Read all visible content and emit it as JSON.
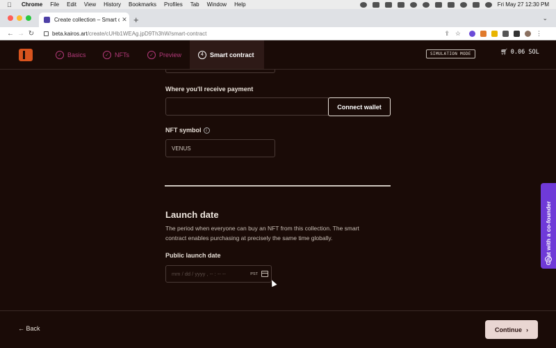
{
  "menubar": {
    "app": "Chrome",
    "items": [
      "File",
      "Edit",
      "View",
      "History",
      "Bookmarks",
      "Profiles",
      "Tab",
      "Window",
      "Help"
    ],
    "clock": "Fri May 27  12:30 PM"
  },
  "browser": {
    "tab_title": "Create collection – Smart cont",
    "url_domain": "beta.kairos.art",
    "url_path": "/create/cUHb1WEAg.jpD9Th3hW/smart-contract"
  },
  "header": {
    "steps": [
      {
        "label": "Basics"
      },
      {
        "label": "NFTs"
      },
      {
        "label": "Preview"
      },
      {
        "label": "Smart contract",
        "number": "4"
      }
    ],
    "simulation_badge": "SIMULATION MODE",
    "cart_amount": "0.06 SOL"
  },
  "form": {
    "payment_label": "Where you'll receive payment",
    "payment_value": "",
    "connect_wallet": "Connect wallet",
    "symbol_label": "NFT symbol",
    "symbol_value": "VENUS",
    "launch_title": "Launch date",
    "launch_desc": "The period when everyone can buy an NFT from this collection. The smart contract enables purchasing at precisely the same time globally.",
    "public_launch_label": "Public launch date",
    "date_placeholder": "mm / dd / yyyy ,  -- : --  --",
    "timezone": "PST"
  },
  "chat": {
    "label": "Chat with a co-founder"
  },
  "footer": {
    "back": "Back",
    "continue": "Continue"
  }
}
